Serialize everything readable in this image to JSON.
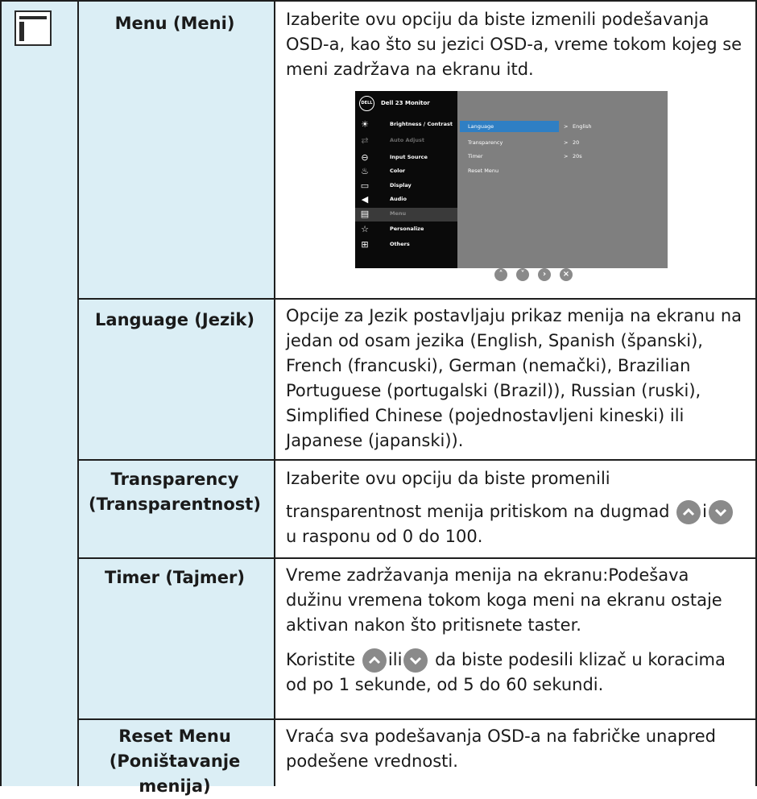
{
  "rows": [
    {
      "name": "Menu (Meni)",
      "desc": "Izaberite ovu opciju da biste izmenili podešavanja OSD-a, kao što su jezici OSD-a, vreme tokom kojeg se meni zadržava na ekranu itd."
    },
    {
      "name": "Language (Jezik)",
      "desc": "Opcije za Jezik postavljaju prikaz menija na ekranu na jedan od osam jezika (English, Spanish (španski), French (francuski), German (nemački), Brazilian Portuguese (portugalski (Brazil)), Russian (ruski), Simplified Chinese (pojednostavljeni kineski) ili Japanese (japanski))."
    },
    {
      "name_line1": "Transparency",
      "name_line2": "(Transparentnost)",
      "desc_p1": "Izaberite ovu opciju da biste promenili",
      "desc_p2_before": "transparentnost menija pritiskom na dugmad",
      "desc_p2_mid": "i",
      "desc_p2_after": "u rasponu od 0 do 100."
    },
    {
      "name": "Timer (Tajmer)",
      "desc_p1": "Vreme zadržavanja menija na ekranu:Podešava dužinu vremena tokom koga meni na ekranu ostaje aktivan nakon što pritisnete taster.",
      "desc_p2_before": "Koristite",
      "desc_p2_mid": "ili",
      "desc_p2_after": "da biste podesili klizač u koracima od po 1 sekunde, od 5 do 60 sekundi."
    },
    {
      "name_line1": "Reset Menu",
      "name_line2": "(Poništavanje",
      "name_line3": "menija)",
      "desc": "Vraća sva podešavanja OSD-a na fabričke unapred podešene vrednosti."
    }
  ],
  "osd": {
    "logo": "DELL",
    "model": "Dell 23 Monitor",
    "items": [
      {
        "label": "Brightness / Contrast",
        "icon": "sun-icon",
        "glyph": "☀"
      },
      {
        "label": "Auto Adjust",
        "icon": "auto-adjust-icon",
        "glyph": "⇄"
      },
      {
        "label": "Input Source",
        "icon": "input-source-icon",
        "glyph": "⊖"
      },
      {
        "label": "Color",
        "icon": "color-icon",
        "glyph": "♨"
      },
      {
        "label": "Display",
        "icon": "display-icon",
        "glyph": "▭"
      },
      {
        "label": "Audio",
        "icon": "audio-icon",
        "glyph": "◀"
      },
      {
        "label": "Menu",
        "icon": "menu-icon",
        "glyph": "▤"
      },
      {
        "label": "Personalize",
        "icon": "star-icon",
        "glyph": "☆"
      },
      {
        "label": "Others",
        "icon": "others-icon",
        "glyph": "⊞"
      }
    ],
    "options": [
      "Language",
      "Transparency",
      "Timer",
      "Reset Menu"
    ],
    "values": [
      "English",
      "20",
      "20s"
    ],
    "arrow": ">"
  },
  "colors": {
    "row_bg": "#dbeef5",
    "osd_highlight": "#2f7fc4",
    "nav_button": "#8a8a8a"
  }
}
